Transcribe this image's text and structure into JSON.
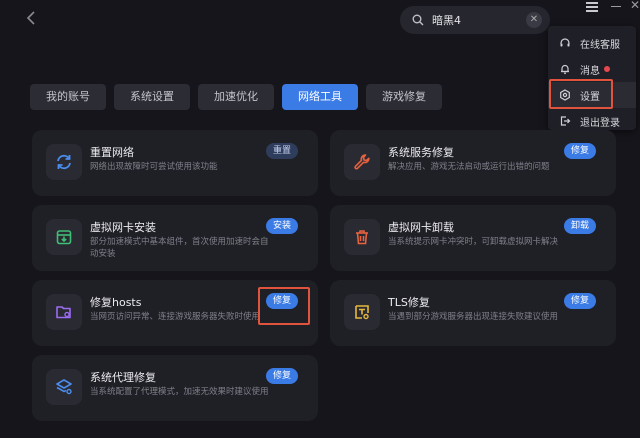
{
  "search": {
    "value": "暗黑4",
    "placeholder": ""
  },
  "dropdown": {
    "items": [
      {
        "label": "在线客服",
        "icon": "headset-icon"
      },
      {
        "label": "消息",
        "icon": "bell-icon",
        "badge": true
      },
      {
        "label": "设置",
        "icon": "settings-icon",
        "highlighted": true
      },
      {
        "label": "退出登录",
        "icon": "logout-icon"
      }
    ]
  },
  "tabs": [
    {
      "label": "我的账号"
    },
    {
      "label": "系统设置"
    },
    {
      "label": "加速优化"
    },
    {
      "label": "网络工具",
      "active": true
    },
    {
      "label": "游戏修复"
    }
  ],
  "cards": [
    {
      "title": "重置网络",
      "desc": "网络出现故障时可尝试使用该功能",
      "button": "重置",
      "icon": "refresh-icon",
      "accent": "#4a8dee"
    },
    {
      "title": "系统服务修复",
      "desc": "解决应用、游戏无法启动或运行出错的问题",
      "button": "修复",
      "icon": "wrench-icon",
      "accent": "#e8623f"
    },
    {
      "title": "虚拟网卡安装",
      "desc": "部分加速模式中基本组件，首次使用加速时会自动安装",
      "button": "安装",
      "icon": "download-box-icon",
      "accent": "#3fbf74"
    },
    {
      "title": "虚拟网卡卸载",
      "desc": "当系统提示网卡冲突时，可卸载虚拟网卡解决",
      "button": "卸载",
      "icon": "trash-icon",
      "accent": "#e8623f"
    },
    {
      "title": "修复hosts",
      "desc": "当网页访问异常、连接游戏服务器失败时使用",
      "button": "修复",
      "icon": "folder-gear-icon",
      "accent": "#9b6cf0"
    },
    {
      "title": "TLS修复",
      "desc": "当遇到部分游戏服务器出现连接失败建议使用",
      "button": "修复",
      "icon": "certificate-icon",
      "accent": "#e8b83a"
    },
    {
      "title": "系统代理修复",
      "desc": "当系统配置了代理模式，加速无效果时建议使用",
      "button": "修复",
      "icon": "layers-gear-icon",
      "accent": "#4a8dee"
    }
  ]
}
